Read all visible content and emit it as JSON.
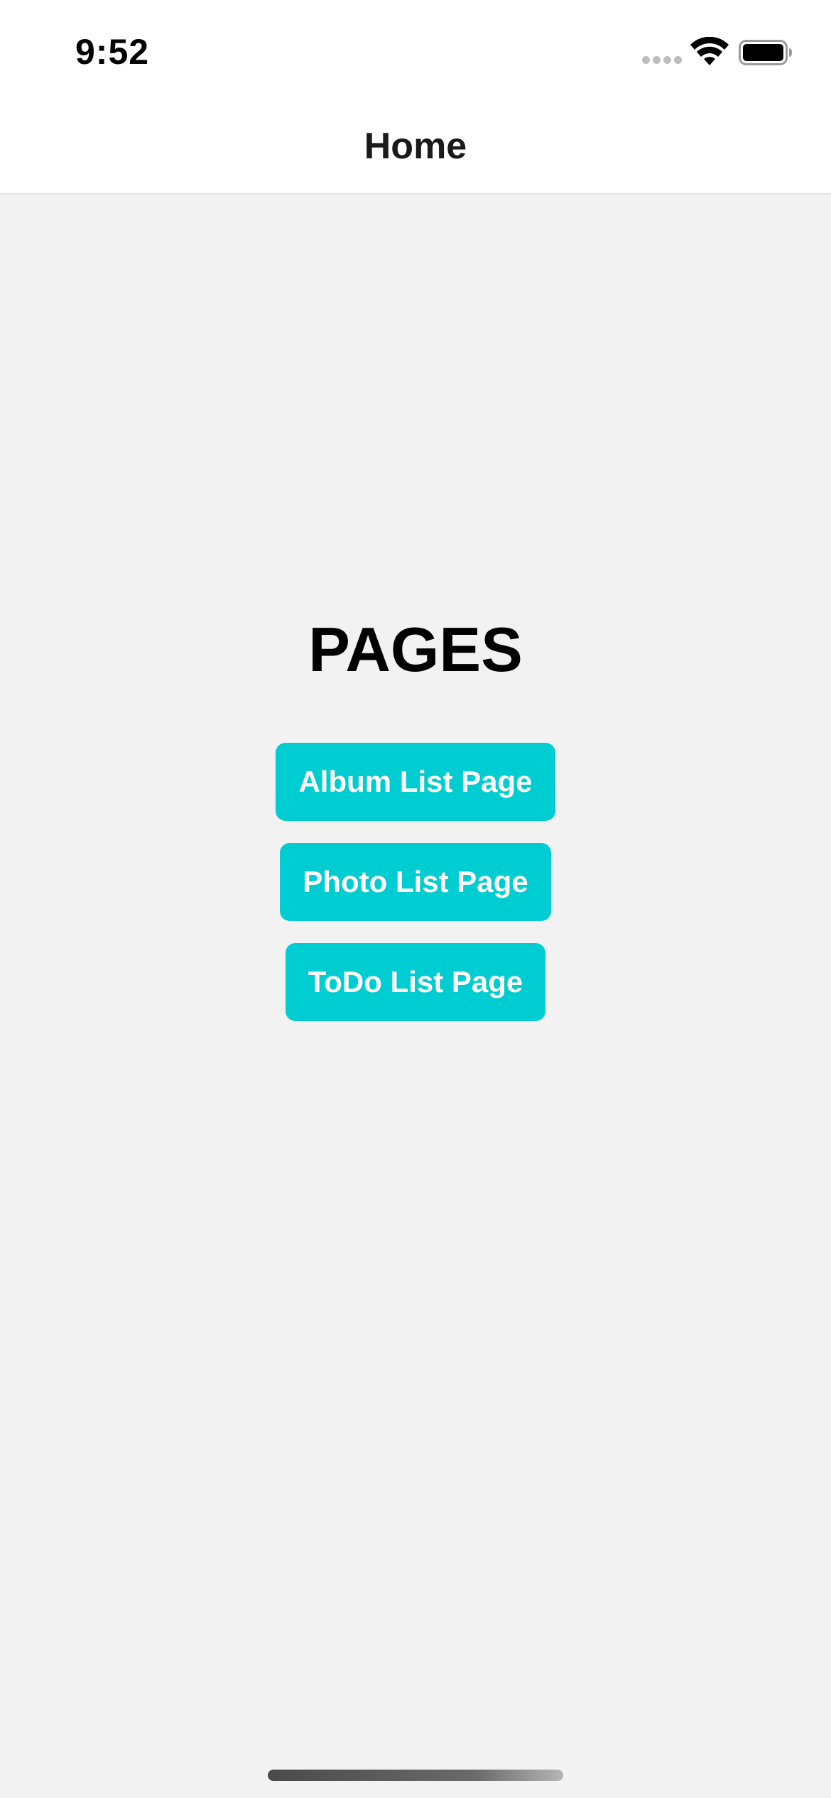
{
  "status_bar": {
    "time": "9:52",
    "icons": [
      "cellular-signal-icon",
      "wifi-icon",
      "battery-icon"
    ]
  },
  "nav_bar": {
    "title": "Home"
  },
  "main": {
    "heading": "PAGES",
    "buttons": [
      {
        "label": "Album List Page"
      },
      {
        "label": "Photo List Page"
      },
      {
        "label": "ToDo List Page"
      }
    ]
  },
  "colors": {
    "accent": "#00cdd1",
    "background": "#f2f2f3",
    "header_background": "#ffffff"
  }
}
